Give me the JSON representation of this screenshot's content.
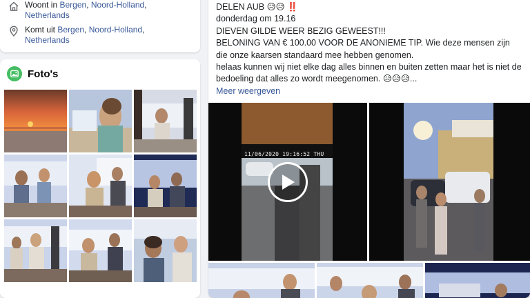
{
  "intro": {
    "lives_in": {
      "prefix": "Woont in",
      "city": "Bergen",
      "region": "Noord-Holland",
      "country": "Netherlands"
    },
    "from": {
      "prefix": "Komt uit",
      "city": "Bergen",
      "region": "Noord-Holland",
      "country": "Netherlands"
    }
  },
  "photos": {
    "title": "Foto's",
    "icon": "photos-icon",
    "count": 9
  },
  "post": {
    "line1": "DELEN AUB 😥😥 ‼️",
    "line2": "donderdag om 19.16",
    "line3": "DIEVEN GILDE WEER BEZIG GEWEEST!!!",
    "line4": "BELONING VAN € 100.00 VOOR DE ANONIEME TIP. Wie deze mensen zijn die onze kaarsen standaard mee hebben genomen.",
    "line5": "helaas kunnen wij niet elke dag alles binnen en buiten zetten maar het is niet de bedoeling dat alles zo wordt meegenomen. 😥😥😥...",
    "more": "Meer weergeven",
    "video_timestamp": "11/06/2020 19:16:52 THU",
    "play_icon": "play-icon"
  },
  "colors": {
    "link": "#385898",
    "background": "#f0f2f5",
    "photos_icon": "#45bd62"
  }
}
